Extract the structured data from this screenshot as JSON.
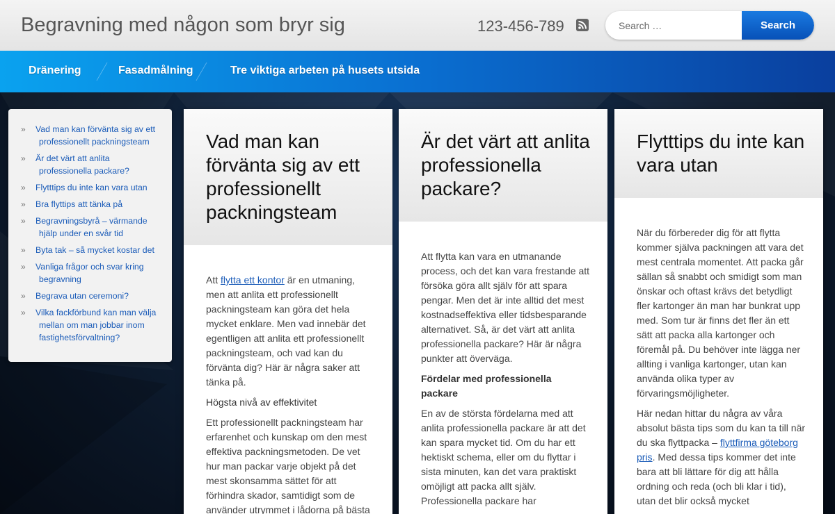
{
  "header": {
    "site_title": "Begravning med någon som bryr sig",
    "phone": "123-456-789",
    "search_placeholder": "Search …",
    "search_button": "Search"
  },
  "nav": {
    "items": [
      "Dränering",
      "Fasadmålning",
      "Tre viktiga arbeten på husets utsida"
    ]
  },
  "sidebar": {
    "items": [
      {
        "line1": "Vad man kan förvänta sig av ett",
        "line2": "professionellt packningsteam"
      },
      {
        "line1": "Är det värt att anlita",
        "line2": "professionella packare?"
      },
      {
        "line1": "Flytttips du inte kan vara utan",
        "line2": ""
      },
      {
        "line1": "Bra flyttips att tänka på",
        "line2": ""
      },
      {
        "line1": "Begravningsbyrå – värmande",
        "line2": "hjälp under en svår tid"
      },
      {
        "line1": "Byta tak – så mycket kostar det",
        "line2": ""
      },
      {
        "line1": "Vanliga frågor och svar kring",
        "line2": "begravning"
      },
      {
        "line1": "Begrava utan ceremoni?",
        "line2": ""
      },
      {
        "line1": "Vilka fackförbund kan man välja",
        "line2": "mellan om man jobbar inom",
        "line3": "fastighetsförvaltning?"
      }
    ]
  },
  "cards": [
    {
      "title": "Vad man kan förvänta sig av ett professionellt packningsteam",
      "p1_before": "Att ",
      "p1_link": "flytta ett kontor",
      "p1_after": " är en utmaning, men att anlita ett professionellt packningsteam kan göra det hela mycket enklare. Men vad innebär det egentligen att anlita ett professionellt packningsteam, och vad kan du förvänta dig? Här är några saker att tänka på.",
      "subhead": "Högsta nivå av effektivitet",
      "p2": "Ett professionellt packningsteam har erfarenhet och kunskap om den mest effektiva packningsmetoden. De vet hur man packar varje objekt på det mest skonsamma sättet för att förhindra skador, samtidigt som de använder utrymmet i lådorna på bästa"
    },
    {
      "title": "Är det värt att anlita professionella packare?",
      "p1": "Att flytta kan vara en utmanande process, och det kan vara frestande att försöka göra allt själv för att spara pengar. Men det är inte alltid det mest kostnadseffektiva eller tidsbesparande alternativet. Så, är det värt att anlita professionella packare? Här är några punkter att överväga.",
      "subhead": "Fördelar med professionella packare",
      "p2": "En av de största fördelarna med att anlita professionella packare är att det kan spara mycket tid. Om du har ett hektiskt schema, eller om du flyttar i sista minuten, kan det vara praktiskt omöjligt att packa allt själv. Professionella packare har"
    },
    {
      "title": "Flytttips du inte kan vara utan",
      "p1": "När du förbereder dig för att flytta kommer själva packningen att vara det mest centrala momentet. Att packa går sällan så snabbt och smidigt som man önskar och oftast krävs det betydligt fler kartonger än man har bunkrat upp med. Som tur är finns det fler än ett sätt att packa alla kartonger och föremål på. Du behöver inte lägga ner allting i vanliga kartonger, utan kan använda olika typer av förvaringsmöjligheter.",
      "p2_before": "Här nedan hittar du några av våra absolut bästa tips som du kan ta till när du ska flyttpacka – ",
      "p2_link": "flyttfirma göteborg pris",
      "p2_after": ". Med dessa tips kommer det inte bara att bli lättare för dig att hålla ordning och reda (och bli klar i tid), utan det blir också mycket"
    }
  ]
}
